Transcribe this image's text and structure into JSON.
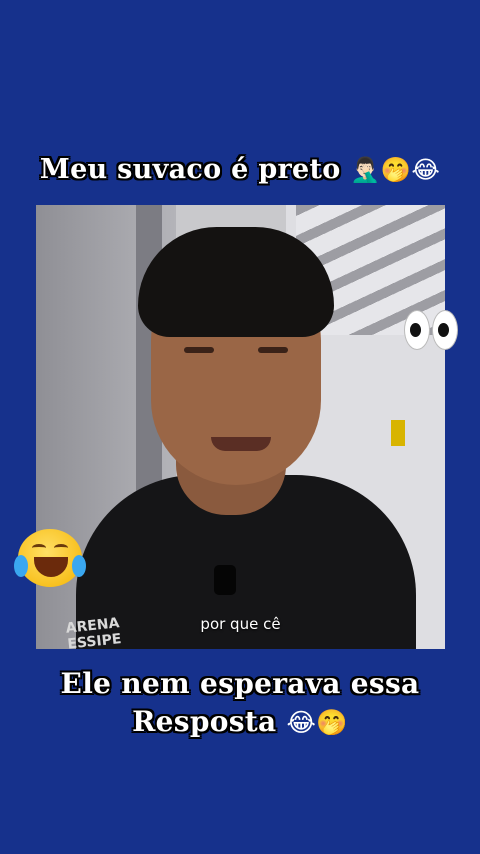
{
  "top_caption": {
    "text": "Meu suvaco é preto",
    "emojis": "🤦🏻‍♂️🤭😂"
  },
  "video": {
    "subtitle": "por que cê",
    "shirt_print": "ARENA ESSIPE"
  },
  "stickers": {
    "eyes": "eyes-emoji",
    "laugh": "face-with-tears-of-joy-emoji"
  },
  "bottom_caption": {
    "line1": "Ele nem esperava essa",
    "line2": "Resposta",
    "emojis": "😂🤭"
  },
  "colors": {
    "background": "#16318c",
    "caption_text": "#ffffff",
    "caption_outline": "#000000"
  }
}
